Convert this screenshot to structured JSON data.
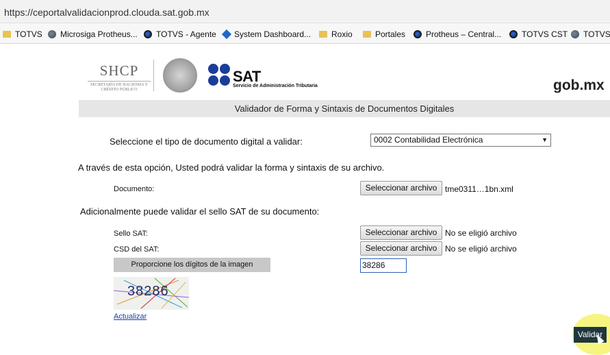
{
  "browser": {
    "url": "https://ceportalvalidacionprod.clouda.sat.gob.mx",
    "bookmarks": [
      {
        "label": "TOTVS",
        "icon": "folder-icon"
      },
      {
        "label": "Microsiga Protheus...",
        "icon": "globe-icon"
      },
      {
        "label": "TOTVS - Agente",
        "icon": "totvs-icon"
      },
      {
        "label": "System Dashboard...",
        "icon": "diamond-icon"
      },
      {
        "label": "Roxio",
        "icon": "folder-icon"
      },
      {
        "label": "Portales",
        "icon": "folder-icon"
      },
      {
        "label": "Protheus – Central...",
        "icon": "totvs-icon"
      },
      {
        "label": "TOTVS CST",
        "icon": "totvs-icon"
      },
      {
        "label": "TOTVS",
        "icon": "globe-icon"
      }
    ]
  },
  "header": {
    "shcp": "SHCP",
    "shcp_sub": "SECRETARÍA DE HACIENDA Y CRÉDITO PÚBLICO",
    "sat": "SAT",
    "sat_sub": "Servicio de Administración Tributaria",
    "gobmx": "gob.mx",
    "brand_blue": "#1b3d9a"
  },
  "form": {
    "title": "Validador de Forma y Sintaxis de Documentos Digitales",
    "type_label": "Seleccione el tipo de documento digital a validar:",
    "type_selected": "0002 Contabilidad Electrónica",
    "info": "A través de esta opción, Usted podrá validar la forma y sintaxis de su archivo.",
    "documento_label": "Documento:",
    "select_file_label": "Seleccionar archivo",
    "documento_file": "tme0311…1bn.xml",
    "additional": "Adicionalmente puede validar el sello SAT de su documento:",
    "sello_label": "Sello SAT:",
    "sello_file": "No se eligió archivo",
    "csd_label": "CSD del SAT:",
    "csd_file": "No se eligió archivo",
    "captcha_prompt": "Proporcione los dígitos de la imagen",
    "captcha_value": "38286",
    "captcha_image_text": "38286",
    "refresh_label": "Actualizar",
    "submit_label": "Validar"
  }
}
